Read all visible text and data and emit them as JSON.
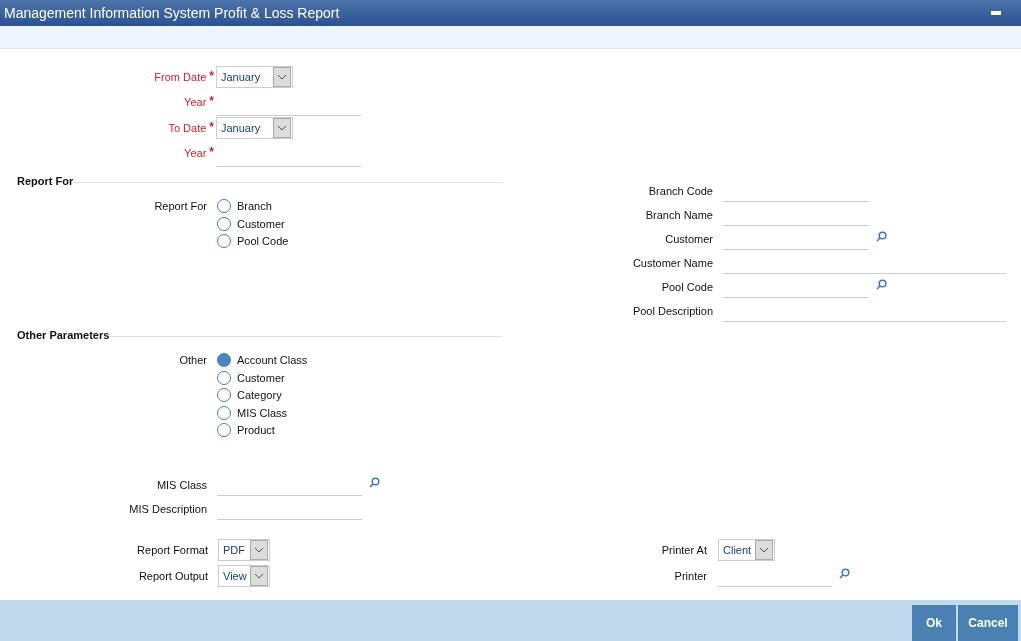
{
  "window": {
    "title": "Management Information System Profit & Loss Report"
  },
  "dates": [
    {
      "label": "From Date",
      "mark": "*",
      "kind": "select",
      "value": "January"
    },
    {
      "label": "Year",
      "mark": "*",
      "kind": "text"
    },
    {
      "label": "To Date",
      "mark": "*",
      "kind": "select",
      "value": "January"
    },
    {
      "label": "Year",
      "mark": "*",
      "kind": "text"
    }
  ],
  "report_for": {
    "heading": "Report For",
    "label": "Report For",
    "options": [
      {
        "label": "Branch",
        "selected": false
      },
      {
        "label": "Customer",
        "selected": false
      },
      {
        "label": "Pool Code",
        "selected": false
      }
    ]
  },
  "report_for_fields": [
    {
      "label": "Branch Code",
      "kind": "short",
      "lookup": false
    },
    {
      "label": "Branch Name",
      "kind": "short",
      "lookup": false
    },
    {
      "label": "Customer",
      "kind": "short",
      "lookup": true
    },
    {
      "label": "Customer Name",
      "kind": "long",
      "lookup": false
    },
    {
      "label": "Pool Code",
      "kind": "short",
      "lookup": true
    },
    {
      "label": "Pool Description",
      "kind": "long",
      "lookup": false
    }
  ],
  "other_parameters": {
    "heading": "Other Parameters",
    "label": "Other",
    "options": [
      {
        "label": "Account Class",
        "selected": true
      },
      {
        "label": "Customer",
        "selected": false
      },
      {
        "label": "Category",
        "selected": false
      },
      {
        "label": "MIS Class",
        "selected": false
      },
      {
        "label": "Product",
        "selected": false
      }
    ]
  },
  "mis_fields": [
    {
      "label": "MIS Class",
      "lookup": true
    },
    {
      "label": "MIS Description",
      "lookup": false
    }
  ],
  "output_fields": [
    {
      "label": "Report Format",
      "value": "PDF"
    },
    {
      "label": "Report Output",
      "value": "View"
    }
  ],
  "printer_fields": [
    {
      "label": "Printer At",
      "kind": "select",
      "value": "Client",
      "lookup": false
    },
    {
      "label": "Printer",
      "kind": "text",
      "lookup": true
    }
  ],
  "buttons": [
    {
      "label": "Ok"
    },
    {
      "label": "Cancel"
    }
  ]
}
